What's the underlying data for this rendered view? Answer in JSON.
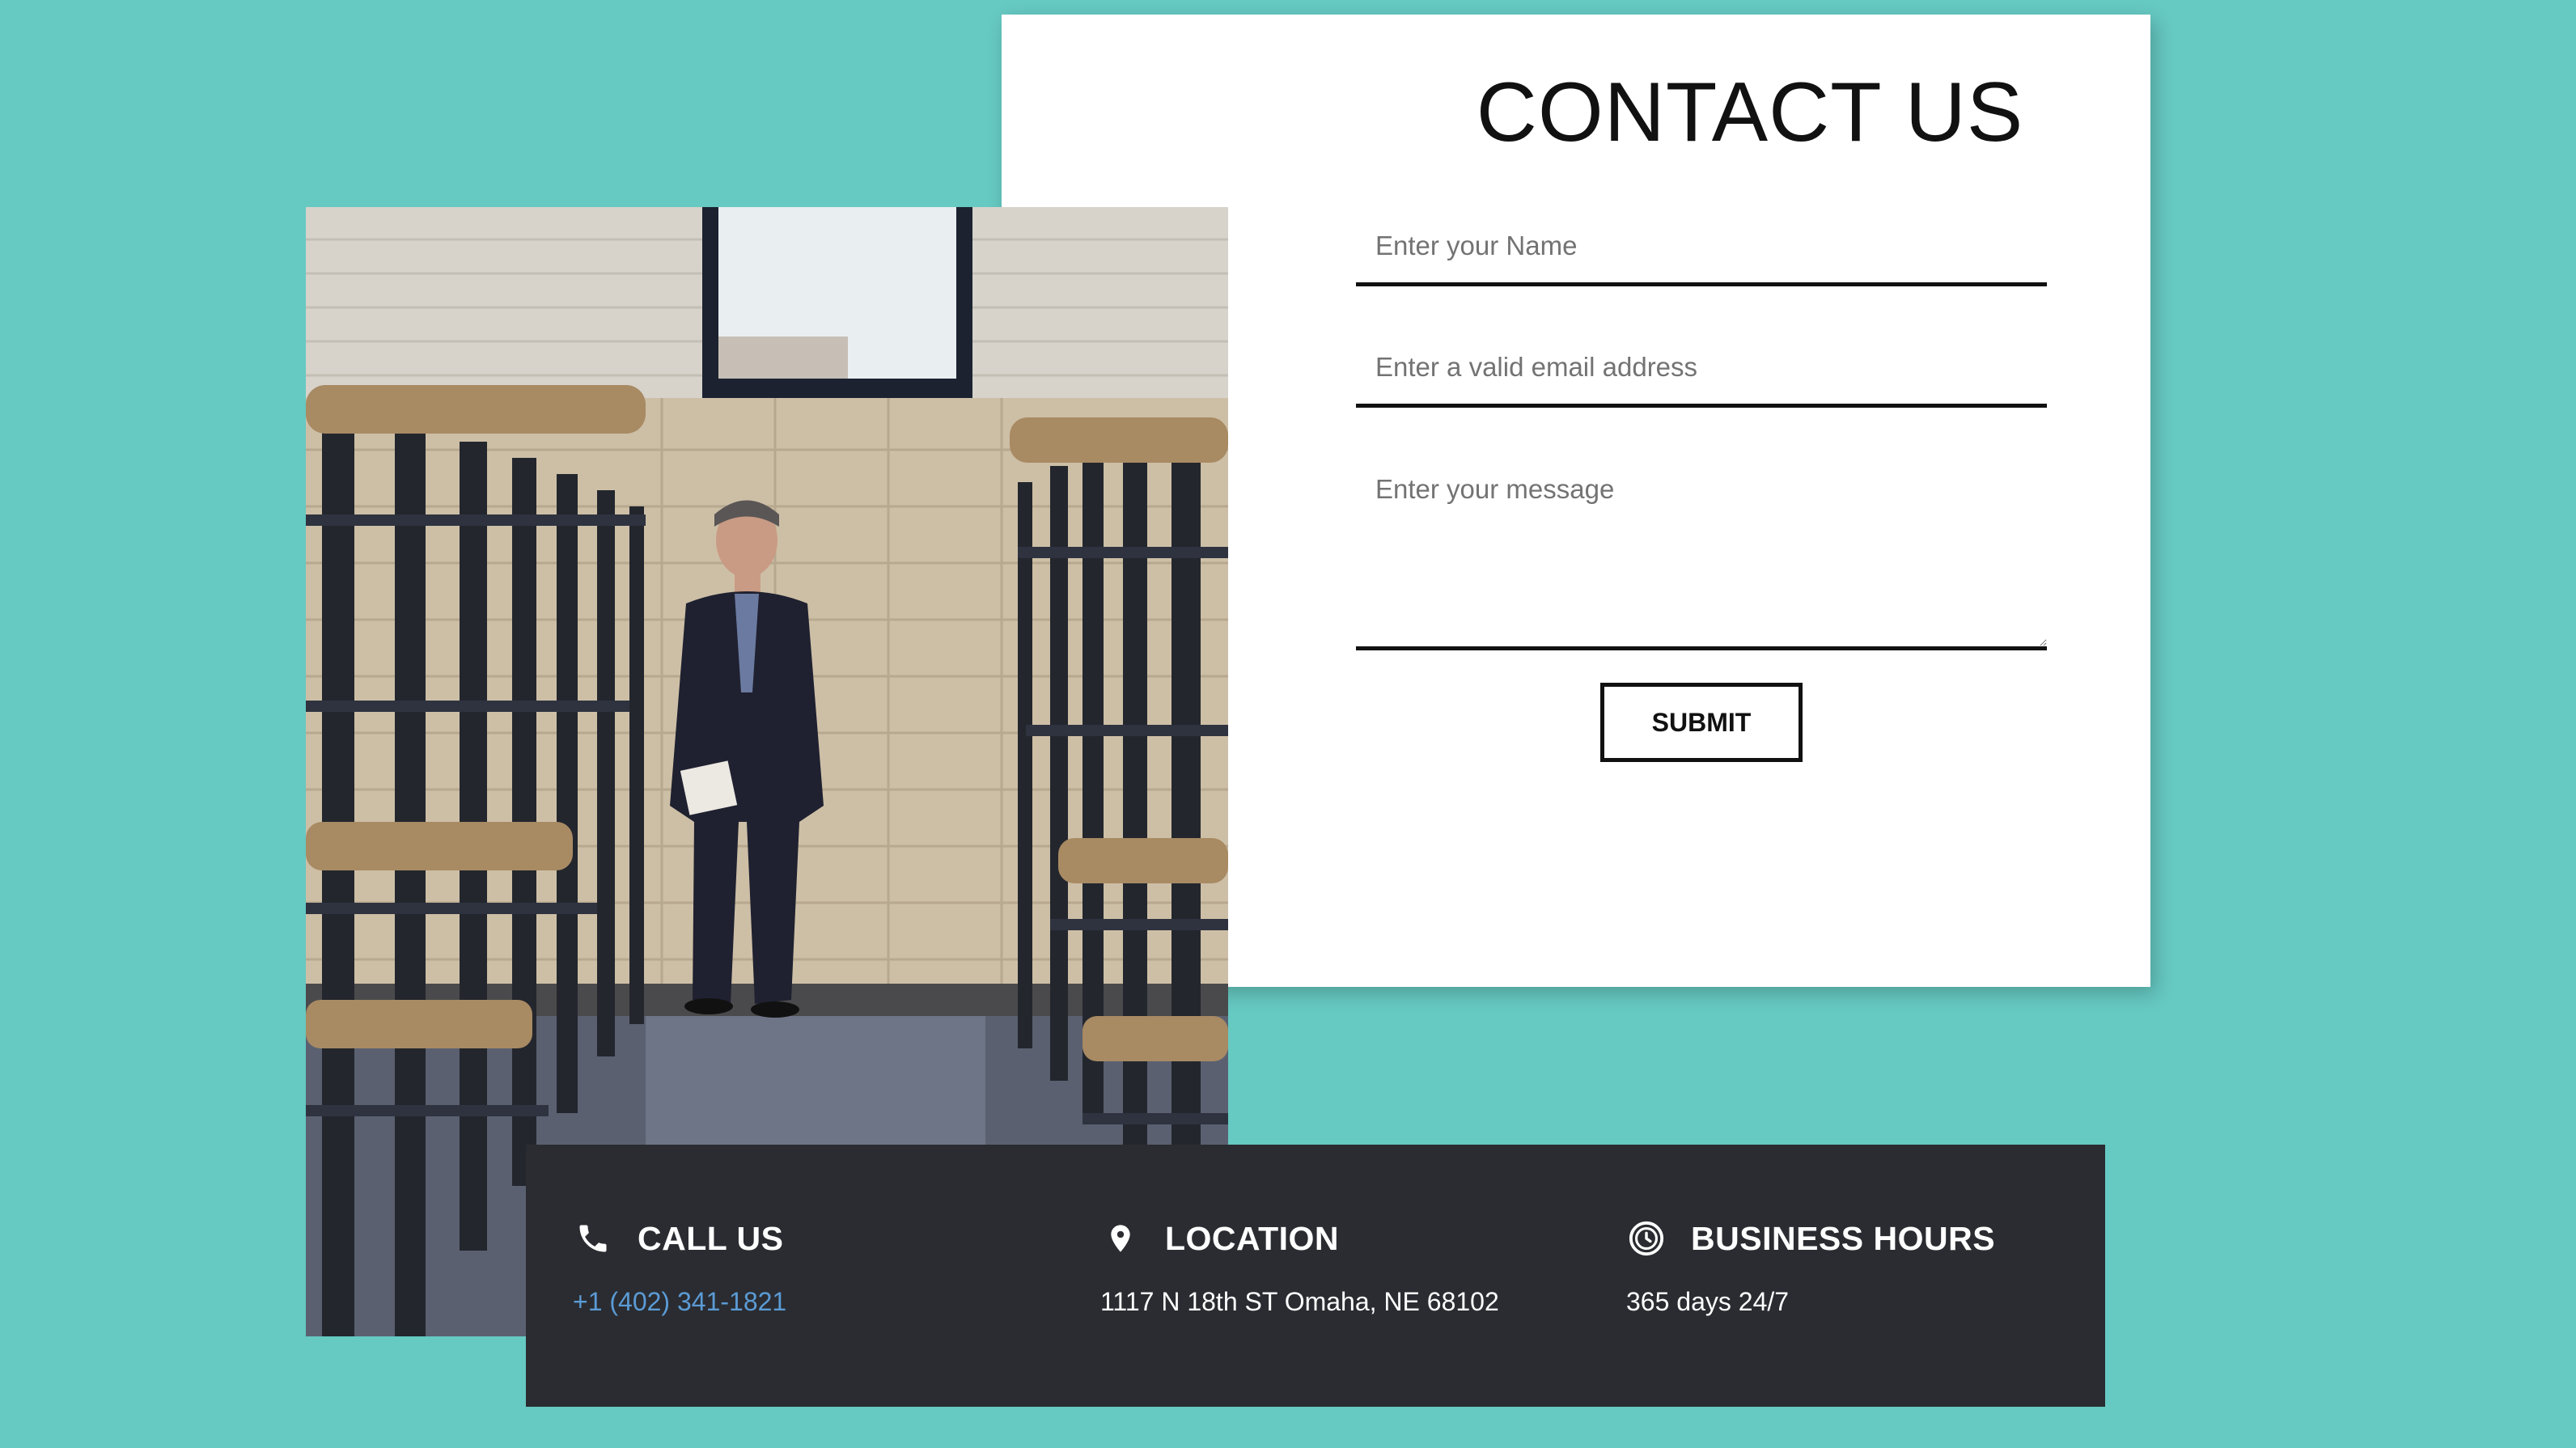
{
  "contact_form": {
    "title": "CONTACT US",
    "name_placeholder": "Enter your Name",
    "email_placeholder": "Enter a valid email address",
    "message_placeholder": "Enter your message",
    "submit_label": "SUBMIT"
  },
  "info": {
    "call": {
      "icon": "phone-icon",
      "heading": "CALL US",
      "value": "+1 (402) 341-1821"
    },
    "location": {
      "icon": "location-pin-icon",
      "heading": "LOCATION",
      "value": "1117 N 18th ST Omaha, NE 68102"
    },
    "hours": {
      "icon": "clock-icon",
      "heading": "BUSINESS HOURS",
      "value": "365 days 24/7"
    }
  },
  "colors": {
    "background": "#66c9c2",
    "card": "#ffffff",
    "info_bar": "#2a2c31",
    "link": "#5b9bd5",
    "text_dark": "#111111"
  }
}
